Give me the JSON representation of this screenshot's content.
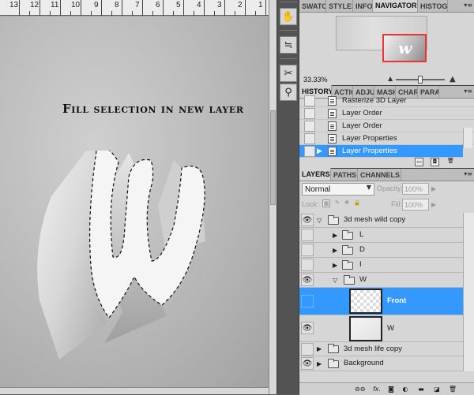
{
  "document": {
    "ruler_labels": [
      "13",
      "12",
      "11",
      "10",
      "9",
      "8",
      "7",
      "6",
      "5",
      "4",
      "3",
      "2",
      "1"
    ],
    "title": "Fill selection in new layer"
  },
  "toolstrip": {
    "tools": [
      "hand-icon",
      "adjustments-icon",
      "tools-icon",
      "pin-icon"
    ]
  },
  "navigator": {
    "tabs": [
      "SWATCI",
      "STYLES",
      "INFO",
      "NAVIGATOR",
      "HISTOG"
    ],
    "active_tab": "NAVIGATOR",
    "zoom": "33.33%",
    "thumbnail_letter": "w"
  },
  "history": {
    "tabs": [
      "HISTORY",
      "ACTIO",
      "ADJU",
      "MASK",
      "CHAR",
      "PARA"
    ],
    "active_tab": "HISTORY",
    "items": [
      {
        "label": "Rasterize 3D Layer",
        "selected": false
      },
      {
        "label": "Layer Order",
        "selected": false
      },
      {
        "label": "Layer Order",
        "selected": false
      },
      {
        "label": "Layer Properties",
        "selected": false
      },
      {
        "label": "Layer Properties",
        "selected": true
      }
    ]
  },
  "layers": {
    "tabs": [
      "LAYERS",
      "PATHS",
      "CHANNELS"
    ],
    "active_tab": "LAYERS",
    "blend_mode": "Normal",
    "opacity_label": "Opacity:",
    "opacity_value": "100%",
    "lock_label": "Lock:",
    "fill_label": "Fill:",
    "fill_value": "100%",
    "rows": [
      {
        "name": "3d mesh wild copy",
        "type": "group",
        "visible": true,
        "expanded": true
      },
      {
        "name": "L",
        "type": "group",
        "visible": false,
        "expanded": false
      },
      {
        "name": "D",
        "type": "group",
        "visible": false,
        "expanded": false
      },
      {
        "name": "I",
        "type": "group",
        "visible": false,
        "expanded": false
      },
      {
        "name": "W",
        "type": "group",
        "visible": true,
        "expanded": true
      },
      {
        "name": "Front",
        "type": "layer",
        "visible": false,
        "selected": true
      },
      {
        "name": "W",
        "type": "layer",
        "visible": true,
        "selected": false
      },
      {
        "name": "3d mesh life copy",
        "type": "group",
        "visible": false,
        "expanded": false
      },
      {
        "name": "Background",
        "type": "group",
        "visible": true,
        "expanded": false
      }
    ],
    "footer_buttons": [
      "link-icon",
      "fx-icon",
      "mask-icon",
      "adjustment-icon",
      "group-icon",
      "new-layer-icon",
      "trash-icon"
    ]
  },
  "colors": {
    "selection": "#3399ff",
    "nav_frame": "#ee3333"
  }
}
